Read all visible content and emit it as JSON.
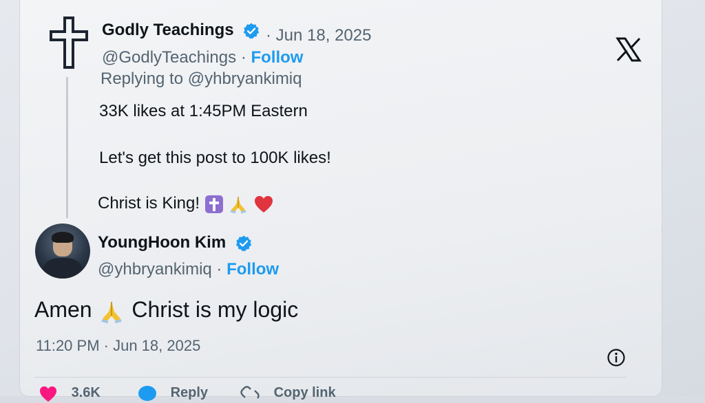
{
  "parent_tweet": {
    "author_name": "Godly Teachings",
    "date_sep": "·",
    "date": "Jun 18, 2025",
    "handle": "@GodlyTeachings",
    "handle_sep": "·",
    "follow_label": "Follow",
    "replying_to": "Replying to @yhbryankimiq",
    "line1": "33K likes at 1:45PM Eastern",
    "line2": "Let's get this post to 100K likes!",
    "line3": "Christ is King!",
    "emojis": [
      "latin-cross-emoji",
      "folded-hands-emoji",
      "red-heart-emoji"
    ]
  },
  "main_tweet": {
    "author_name": "YoungHoon Kim",
    "handle": "@yhbryankimiq",
    "handle_sep": "·",
    "follow_label": "Follow",
    "text_before": "Amen",
    "text_after": "Christ is my logic",
    "timestamp": "11:20 PM · Jun 18, 2025"
  },
  "actions": {
    "like_count": "3.6K",
    "reply_label": "Reply",
    "copy_link_label": "Copy link"
  },
  "colors": {
    "accent": "#1d9bf0",
    "text": "#0f1419",
    "secondary": "#536471",
    "like": "#f91880"
  },
  "icons": {
    "logo": "x-logo-icon",
    "verified": "verified-badge-icon",
    "info": "info-icon"
  }
}
